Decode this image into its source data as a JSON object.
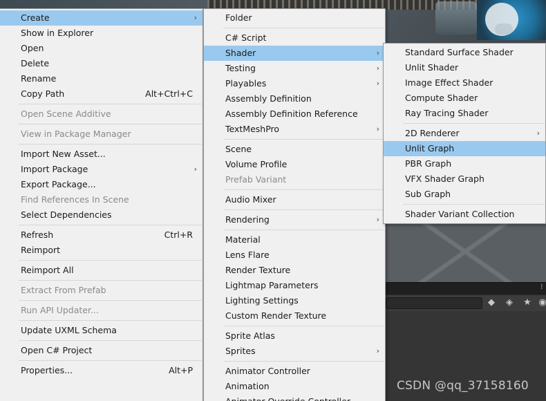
{
  "main_menu": {
    "items": [
      {
        "label": "Create",
        "arrow": true,
        "highlight": true
      },
      {
        "label": "Show in Explorer"
      },
      {
        "label": "Open"
      },
      {
        "label": "Delete"
      },
      {
        "label": "Rename"
      },
      {
        "label": "Copy Path",
        "shortcut": "Alt+Ctrl+C"
      },
      {
        "sep": true
      },
      {
        "label": "Open Scene Additive",
        "disabled": true
      },
      {
        "sep": true
      },
      {
        "label": "View in Package Manager",
        "disabled": true
      },
      {
        "sep": true
      },
      {
        "label": "Import New Asset..."
      },
      {
        "label": "Import Package",
        "arrow": true
      },
      {
        "label": "Export Package..."
      },
      {
        "label": "Find References In Scene",
        "disabled": true
      },
      {
        "label": "Select Dependencies"
      },
      {
        "sep": true
      },
      {
        "label": "Refresh",
        "shortcut": "Ctrl+R"
      },
      {
        "label": "Reimport"
      },
      {
        "sep": true
      },
      {
        "label": "Reimport All"
      },
      {
        "sep": true
      },
      {
        "label": "Extract From Prefab",
        "disabled": true
      },
      {
        "sep": true
      },
      {
        "label": "Run API Updater...",
        "disabled": true
      },
      {
        "sep": true
      },
      {
        "label": "Update UXML Schema"
      },
      {
        "sep": true
      },
      {
        "label": "Open C# Project"
      },
      {
        "sep": true
      },
      {
        "label": "Properties...",
        "shortcut": "Alt+P"
      }
    ]
  },
  "create_menu": {
    "items": [
      {
        "label": "Folder"
      },
      {
        "sep": true
      },
      {
        "label": "C# Script"
      },
      {
        "label": "Shader",
        "arrow": true,
        "highlight": true
      },
      {
        "label": "Testing",
        "arrow": true
      },
      {
        "label": "Playables",
        "arrow": true
      },
      {
        "label": "Assembly Definition"
      },
      {
        "label": "Assembly Definition Reference"
      },
      {
        "label": "TextMeshPro",
        "arrow": true
      },
      {
        "sep": true
      },
      {
        "label": "Scene"
      },
      {
        "label": "Volume Profile"
      },
      {
        "label": "Prefab Variant",
        "disabled": true
      },
      {
        "sep": true
      },
      {
        "label": "Audio Mixer"
      },
      {
        "sep": true
      },
      {
        "label": "Rendering",
        "arrow": true
      },
      {
        "sep": true
      },
      {
        "label": "Material"
      },
      {
        "label": "Lens Flare"
      },
      {
        "label": "Render Texture"
      },
      {
        "label": "Lightmap Parameters"
      },
      {
        "label": "Lighting Settings"
      },
      {
        "label": "Custom Render Texture"
      },
      {
        "sep": true
      },
      {
        "label": "Sprite Atlas"
      },
      {
        "label": "Sprites",
        "arrow": true
      },
      {
        "sep": true
      },
      {
        "label": "Animator Controller"
      },
      {
        "label": "Animation"
      },
      {
        "label": "Animator Override Controller"
      }
    ]
  },
  "shader_menu": {
    "items": [
      {
        "label": "Standard Surface Shader"
      },
      {
        "label": "Unlit Shader"
      },
      {
        "label": "Image Effect Shader"
      },
      {
        "label": "Compute Shader"
      },
      {
        "label": "Ray Tracing Shader"
      },
      {
        "sep": true
      },
      {
        "label": "2D Renderer",
        "arrow": true
      },
      {
        "label": "Unlit Graph",
        "highlight": true
      },
      {
        "label": "PBR Graph"
      },
      {
        "label": "VFX Shader Graph"
      },
      {
        "label": "Sub Graph"
      },
      {
        "sep": true
      },
      {
        "label": "Shader Variant Collection"
      }
    ]
  },
  "watermark": "CSDN @qq_37158160",
  "arrow_glyph": "›",
  "colors": {
    "menu_bg": "#f0f0f0",
    "highlight": "#99c9ef",
    "disabled_text": "#8a8a8a"
  }
}
